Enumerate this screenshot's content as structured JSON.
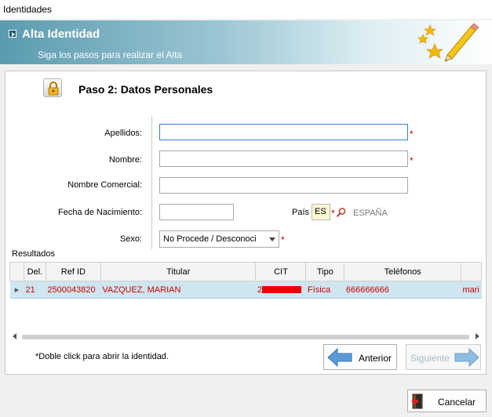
{
  "window": {
    "title": "Identidades"
  },
  "header": {
    "title": "Alta Identidad",
    "subtitle": "Siga los pasos para realizar el Alta"
  },
  "step": {
    "title": "Paso 2: Datos Personales"
  },
  "form": {
    "apellidos_label": "Apellidos:",
    "apellidos_value": "",
    "nombre_label": "Nombre:",
    "nombre_value": "",
    "nombre_comercial_label": "Nombre Comercial:",
    "nombre_comercial_value": "",
    "fecha_label": "Fecha de Nacimiento:",
    "fecha_value": "",
    "pais_label": "País",
    "pais_code": "ES",
    "pais_name": "ESPAÑA",
    "sexo_label": "Sexo:",
    "sexo_value": "No Procede / Desconoci",
    "required_mark": "*"
  },
  "results": {
    "label": "Resultados",
    "columns": [
      "Del.",
      "Ref ID",
      "Titular",
      "CIT",
      "Tipo",
      "Teléfonos",
      ""
    ],
    "rows": [
      {
        "del": "21",
        "ref_id": "2500043820",
        "titular": "VAZQUEZ, MARIAN",
        "cit": "2",
        "tipo": "Física",
        "telefonos": "666666666",
        "extra": "mari"
      }
    ]
  },
  "footnote": "*Doble click para abrir la identidad.",
  "buttons": {
    "anterior": "Anterior",
    "siguiente": "Siguiente",
    "cancelar": "Cancelar"
  },
  "colors": {
    "required": "#cc0000",
    "row_text": "#d00000",
    "selected_row": "#cfe5ef",
    "nav_arrow": "#5b9bd5"
  }
}
